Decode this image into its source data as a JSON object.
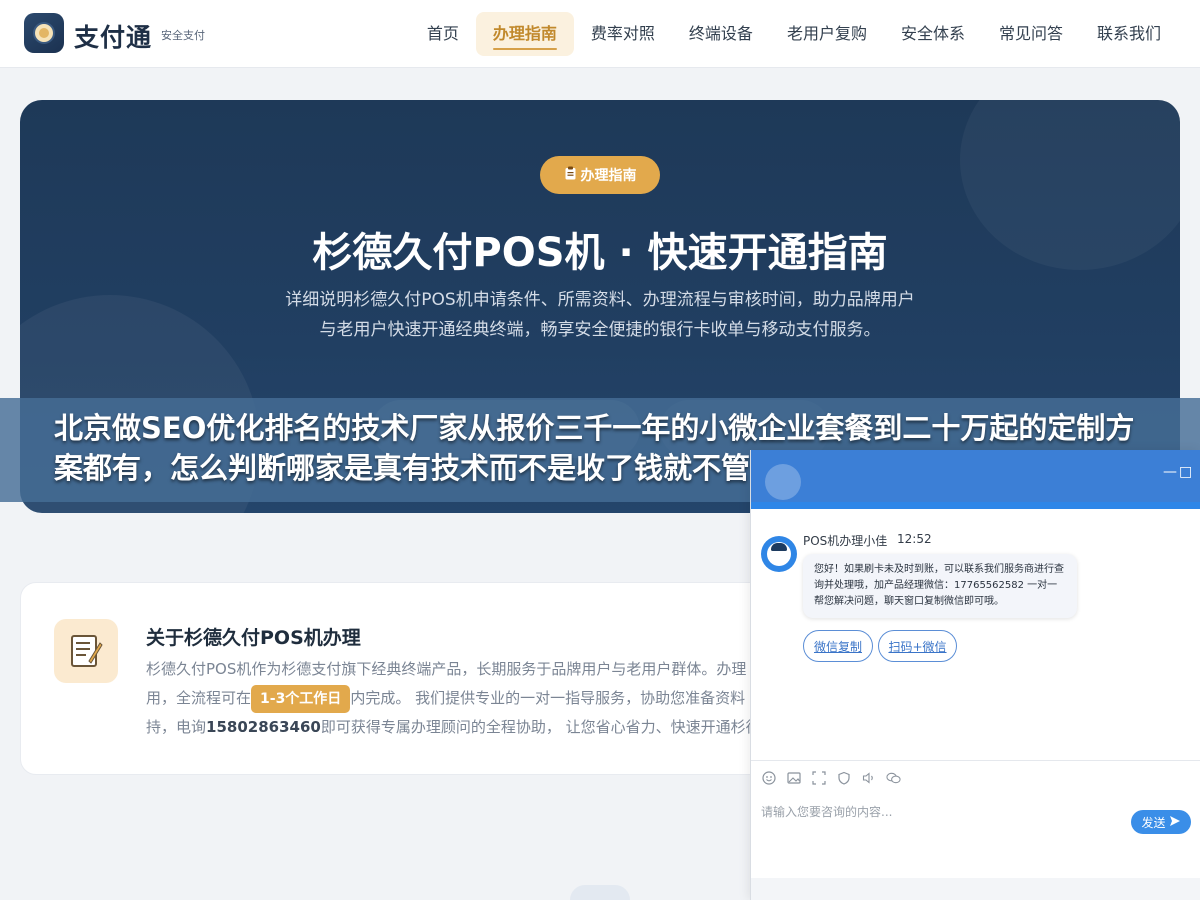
{
  "header": {
    "brand": "支付通",
    "brand_sub": "安全支付",
    "nav": [
      "首页",
      "办理指南",
      "费率对照",
      "终端设备",
      "老用户复购",
      "安全体系",
      "常见问答",
      "联系我们"
    ],
    "active_nav": "办理指南"
  },
  "hero": {
    "badge_icon": "clipboard-icon",
    "badge": "办理指南",
    "title": "杉德久付POS机 · 快速开通指南",
    "description": "详细说明杉德久付POS机申请条件、所需资料、办理流程与审核时间，助力品牌用户与老用户快速开通经典终端，畅享安全便捷的银行卡收单与移动支付服务。"
  },
  "banner": {
    "text": "北京做SEO优化排名的技术厂家从报价三千一年的小微企业套餐到二十万起的定制方案都有，怎么判断哪家是真有技术而不是收了钱就不管了？看"
  },
  "about": {
    "icon": "memo-icon",
    "title": "关于杉德久付POS机办理",
    "body_1": "杉德久付POS机作为杉德支付旗下经典终端产品，长期服务于品牌用户与老用户群体。办理",
    "body_2": "用，全流程可在",
    "pill": "1-3个工作日",
    "body_3": "内完成。 我们提供专业的一对一指导服务，协助您准备资料",
    "body_4": "持，电询",
    "phone": "15802863460",
    "body_5": "即可获得专属办理顾问的全程协助， 让您省心省力、快速开通杉德"
  },
  "chat": {
    "window_controls": [
      "—",
      "□"
    ],
    "agent_name": "POS机办理小佳",
    "time": "12:52",
    "message": "您好！如果刷卡未及时到账，可以联系我们服务商进行查询并处理哦，加产品经理微信：17765562582 一对一帮您解决问题，聊天窗口复制微信即可哦。",
    "buttons": [
      "微信复制",
      "扫码+微信"
    ],
    "toolbar_icons": [
      "emoji-icon",
      "image-icon",
      "screenshot-icon",
      "rate-icon",
      "voice-icon",
      "wechat-icon"
    ],
    "input_placeholder": "请输入您要咨询的内容...",
    "send_label": "发送"
  },
  "colors": {
    "accent_gold": "#e2a94c",
    "hero_navy": "#1e3958",
    "chat_blue": "#3c7fd6"
  }
}
